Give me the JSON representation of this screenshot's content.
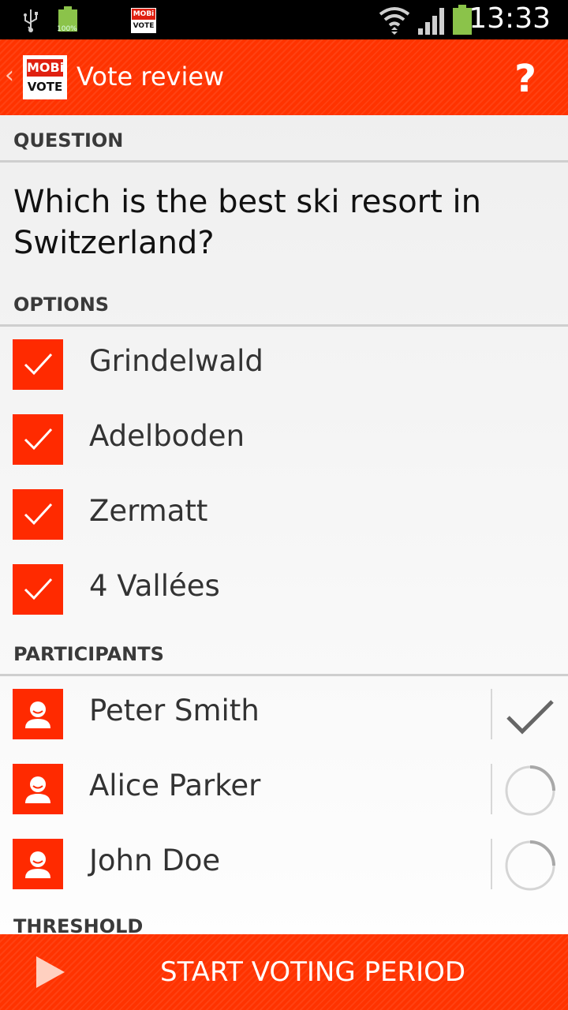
{
  "status_bar": {
    "time": "13:33",
    "battery_small_label": "100%",
    "app_badge_line1": "MOBi",
    "app_badge_line2": "VOTE",
    "icons": [
      "usb-icon",
      "battery-full-icon",
      "mobivote-notification-icon",
      "wifi-icon",
      "signal-icon",
      "battery-icon"
    ]
  },
  "action_bar": {
    "logo_line1": "MOBi",
    "logo_line2": "VOTE",
    "title": "Vote review",
    "help_label": "?",
    "color": "#ff3300"
  },
  "sections": {
    "question_header": "QUESTION",
    "options_header": "OPTIONS",
    "participants_header": "PARTICIPANTS",
    "threshold_header": "THRESHOLD"
  },
  "question": "Which is the best ski resort in Switzerland?",
  "options": [
    {
      "label": "Grindelwald",
      "checked": true
    },
    {
      "label": "Adelboden",
      "checked": true
    },
    {
      "label": "Zermatt",
      "checked": true
    },
    {
      "label": "4 Vallées",
      "checked": true
    }
  ],
  "participants": [
    {
      "name": "Peter Smith",
      "status": "voted"
    },
    {
      "name": "Alice Parker",
      "status": "pending"
    },
    {
      "name": "John Doe",
      "status": "pending"
    }
  ],
  "bottom_bar": {
    "label": "START VOTING PERIOD",
    "icon": "play-icon"
  }
}
